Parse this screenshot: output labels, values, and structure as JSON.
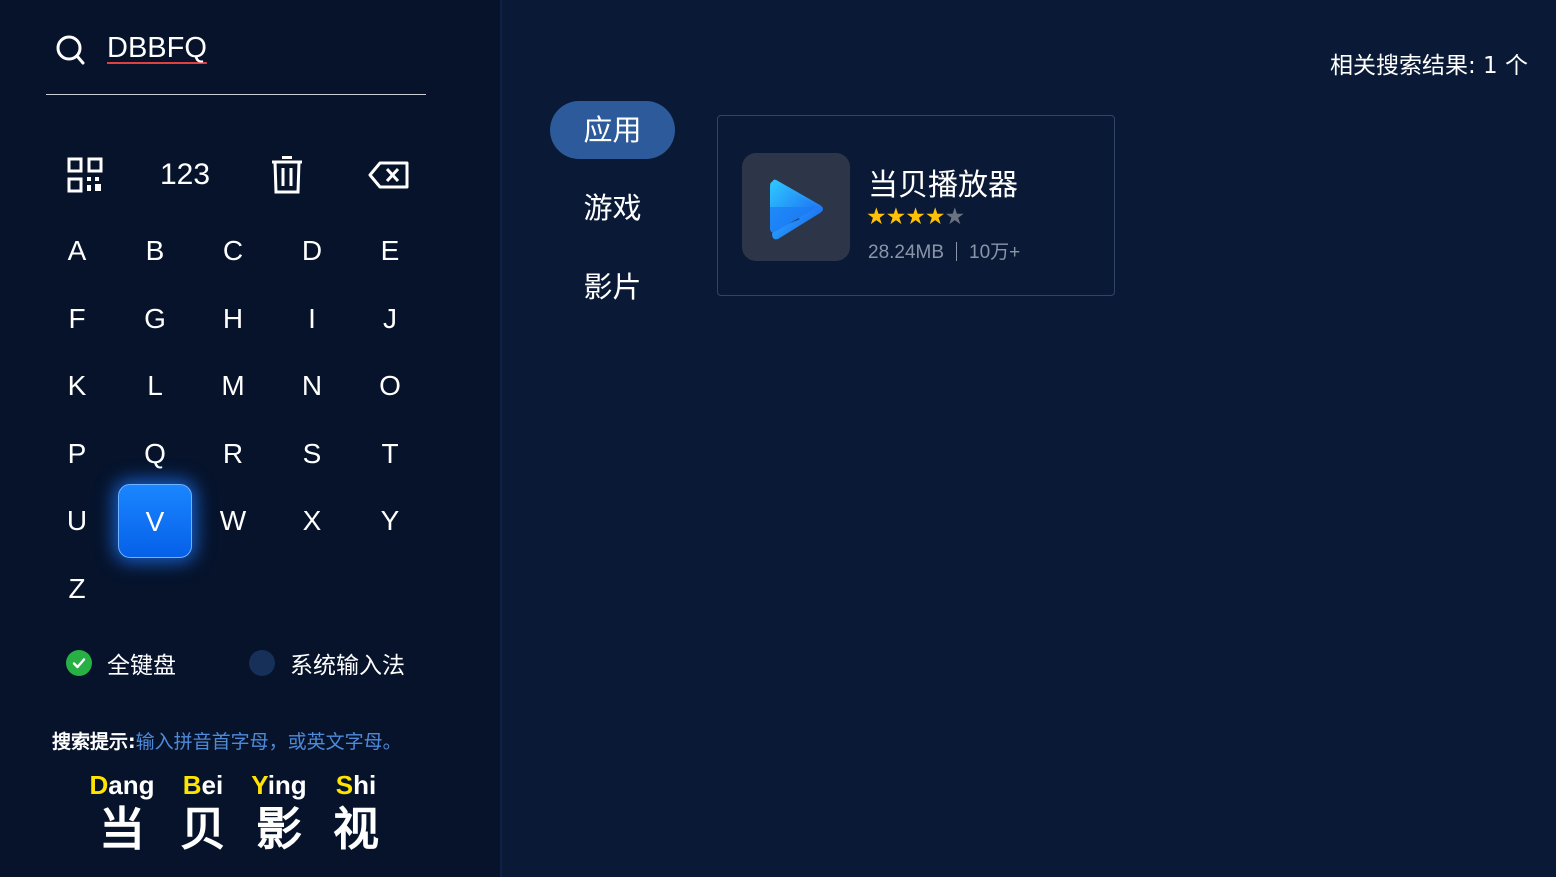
{
  "search": {
    "query": "DBBFQ",
    "result_label": "相关搜索结果:",
    "result_count": "1 个"
  },
  "keyboard": {
    "tools": [
      {
        "name": "qr-code",
        "label": ""
      },
      {
        "name": "numeric",
        "label": "123"
      },
      {
        "name": "clear",
        "label": ""
      },
      {
        "name": "backspace",
        "label": ""
      }
    ],
    "letters": [
      "A",
      "B",
      "C",
      "D",
      "E",
      "F",
      "G",
      "H",
      "I",
      "J",
      "K",
      "L",
      "M",
      "N",
      "O",
      "P",
      "Q",
      "R",
      "S",
      "T",
      "U",
      "V",
      "W",
      "X",
      "Y",
      "Z"
    ],
    "active_key": "V"
  },
  "input_modes": [
    {
      "label": "全键盘",
      "selected": true
    },
    {
      "label": "系统输入法",
      "selected": false
    }
  ],
  "hint": {
    "label": "搜索提示:",
    "text": "输入拼音首字母，或英文字母。"
  },
  "pinyin_example": [
    {
      "initial": "D",
      "rest": "ang",
      "hanzi": "当"
    },
    {
      "initial": "B",
      "rest": "ei",
      "hanzi": "贝"
    },
    {
      "initial": "Y",
      "rest": "ing",
      "hanzi": "影"
    },
    {
      "initial": "S",
      "rest": "hi",
      "hanzi": "视"
    }
  ],
  "categories": [
    {
      "label": "应用",
      "active": true
    },
    {
      "label": "游戏",
      "active": false
    },
    {
      "label": "影片",
      "active": false
    }
  ],
  "results": [
    {
      "name": "当贝播放器",
      "rating": 4,
      "rating_max": 5,
      "size": "28.24MB",
      "downloads": "10万+",
      "icon": "play-icon"
    }
  ],
  "colors": {
    "background": "#0a1a36",
    "panel": "#06132b",
    "accent": "#0a6cf0",
    "active_category": "#2d5a9a",
    "star": "#ffc107",
    "pinyin_initial": "#ffe400",
    "check": "#27b043"
  }
}
